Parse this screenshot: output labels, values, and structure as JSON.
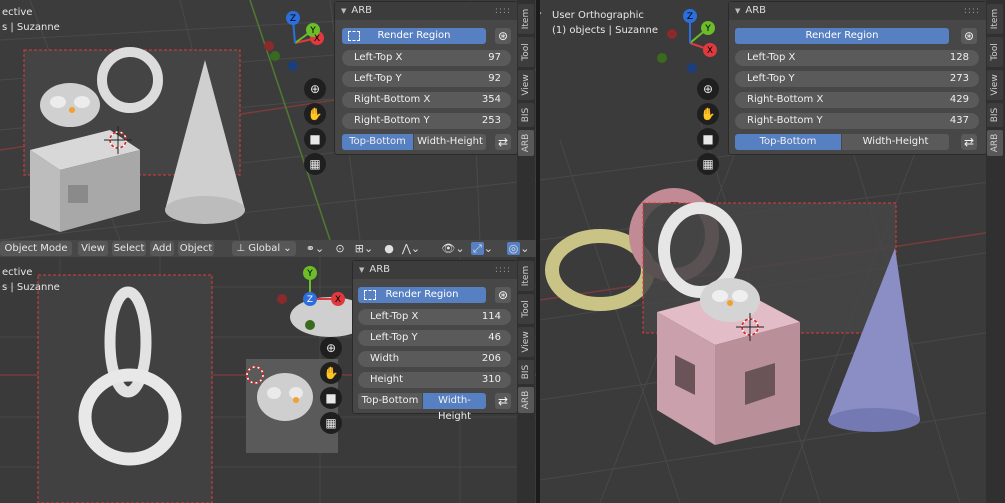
{
  "arb_panel": {
    "title": "ARB",
    "render_region_label": "Render Region",
    "mode_top_bottom": "Top-Bottom",
    "mode_width_height": "Width-Height"
  },
  "tabs": {
    "item": "Item",
    "tool": "Tool",
    "view": "View",
    "bis": "BIS",
    "arb": "ARB"
  },
  "viewport_top_left": {
    "title_fragment": "ective",
    "objects_fragment": "s | Suzanne",
    "fields": [
      {
        "label": "Left-Top X",
        "value": "97"
      },
      {
        "label": "Left-Top Y",
        "value": "92"
      },
      {
        "label": "Right-Bottom X",
        "value": "354"
      },
      {
        "label": "Right-Bottom Y",
        "value": "253"
      }
    ],
    "active_mode": "top-bottom"
  },
  "viewport_bottom_left": {
    "title_fragment": "ective",
    "objects_fragment": "s | Suzanne",
    "fields": [
      {
        "label": "Left-Top X",
        "value": "114"
      },
      {
        "label": "Left-Top Y",
        "value": "46"
      },
      {
        "label": "Width",
        "value": "206"
      },
      {
        "label": "Height",
        "value": "310"
      }
    ],
    "active_mode": "width-height"
  },
  "viewport_right": {
    "title": "User Orthographic",
    "objects": "(1) objects | Suzanne",
    "fields": [
      {
        "label": "Left-Top X",
        "value": "128"
      },
      {
        "label": "Left-Top Y",
        "value": "273"
      },
      {
        "label": "Right-Bottom X",
        "value": "429"
      },
      {
        "label": "Right-Bottom Y",
        "value": "437"
      }
    ],
    "active_mode": "top-bottom"
  },
  "header": {
    "mode": "Object Mode",
    "view": "View",
    "select": "Select",
    "add": "Add",
    "object": "Object",
    "orientation": "Global"
  },
  "gizmo_labels": {
    "x": "X",
    "y": "Y",
    "z": "Z"
  },
  "colors": {
    "accent_blue": "#5680c2",
    "panel_bg": "#474747",
    "field_bg": "#5a5a5a",
    "axis_x": "#e0393e",
    "axis_y": "#6bbd29",
    "axis_z": "#2c6fdc"
  }
}
